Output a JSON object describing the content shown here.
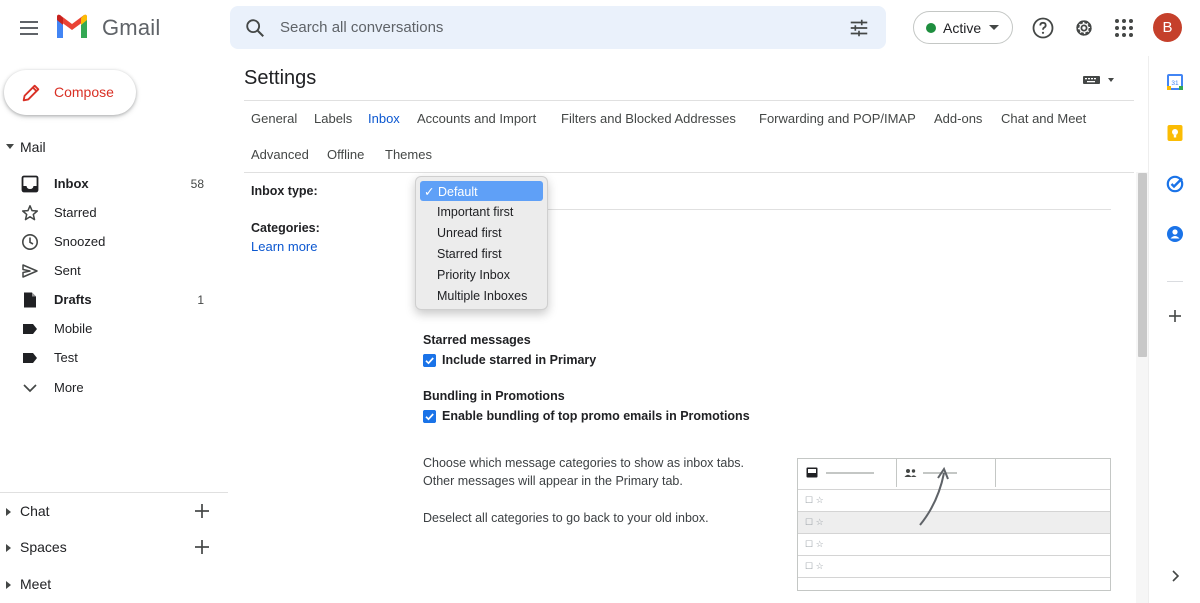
{
  "app": {
    "name": "Gmail"
  },
  "search": {
    "placeholder": "Search all conversations"
  },
  "status": {
    "label": "Active",
    "color": "#1e8e3e"
  },
  "account": {
    "initial": "B",
    "color": "#c5402b"
  },
  "compose": {
    "label": "Compose"
  },
  "sidebar": {
    "mail_header": "Mail",
    "items": [
      {
        "label": "Inbox",
        "count": "58",
        "bold": true,
        "icon": "inbox-icon"
      },
      {
        "label": "Starred",
        "count": "",
        "bold": false,
        "icon": "star-icon"
      },
      {
        "label": "Snoozed",
        "count": "",
        "bold": false,
        "icon": "clock-icon"
      },
      {
        "label": "Sent",
        "count": "",
        "bold": false,
        "icon": "send-icon"
      },
      {
        "label": "Drafts",
        "count": "1",
        "bold": true,
        "icon": "draft-icon"
      },
      {
        "label": "Mobile",
        "count": "",
        "bold": false,
        "icon": "label-icon"
      },
      {
        "label": "Test",
        "count": "",
        "bold": false,
        "icon": "label-icon"
      },
      {
        "label": "More",
        "count": "",
        "bold": false,
        "icon": "chevron-down-icon"
      }
    ],
    "chat_header": "Chat",
    "spaces_header": "Spaces",
    "meet_header": "Meet"
  },
  "settings": {
    "title": "Settings",
    "tabs_row1": [
      "General",
      "Labels",
      "Inbox",
      "Accounts and Import",
      "Filters and Blocked Addresses",
      "Forwarding and POP/IMAP",
      "Add-ons",
      "Chat and Meet"
    ],
    "tabs_row2": [
      "Advanced",
      "Offline",
      "Themes"
    ],
    "active_tab": "Inbox",
    "inbox_type_label": "Inbox type:",
    "categories_label": "Categories:",
    "learn_more": "Learn more",
    "inbox_type_options": [
      "Default",
      "Important first",
      "Unread first",
      "Starred first",
      "Priority Inbox",
      "Multiple Inboxes"
    ],
    "inbox_type_selected": "Default",
    "checkmark": "✓",
    "starred_section": "Starred messages",
    "starred_option": "Include starred in Primary",
    "bundling_section": "Bundling in Promotions",
    "bundling_option": "Enable bundling of top promo emails in Promotions",
    "desc_line1": "Choose which message categories to show as inbox tabs.",
    "desc_line2": "Other messages will appear in the Primary tab.",
    "desc_line3": "Deselect all categories to go back to your old inbox."
  },
  "side_panel": {
    "icons": [
      "calendar-icon",
      "keep-icon",
      "tasks-icon",
      "contacts-icon",
      "add-icon",
      "chevron-right-icon"
    ],
    "calendar_day": "31"
  },
  "colors": {
    "accent": "#0b57d0",
    "compose_text": "#d93025",
    "checkbox": "#1a73e8",
    "dropdown_selected": "#5fa0f7"
  }
}
